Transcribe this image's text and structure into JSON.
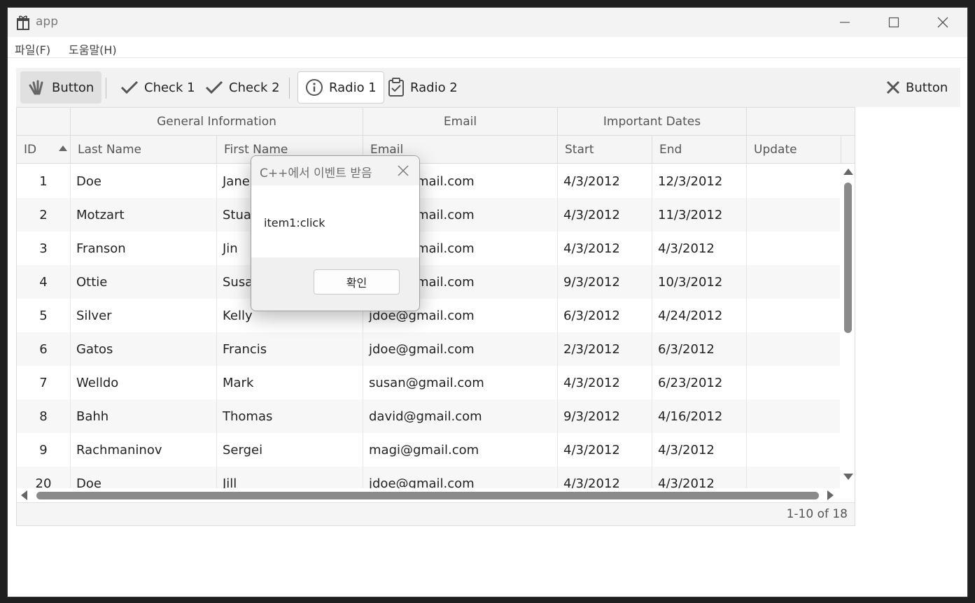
{
  "window": {
    "title": "app"
  },
  "menu": {
    "file": "파일(F)",
    "help": "도움말(H)"
  },
  "toolbar": {
    "button1": "Button",
    "check1": "Check 1",
    "check2": "Check 2",
    "radio1": "Radio 1",
    "radio2": "Radio 2",
    "button2": "Button"
  },
  "grid": {
    "groups": {
      "general": "General Information",
      "email": "Email",
      "dates": "Important Dates"
    },
    "columns": {
      "id": "ID",
      "last": "Last Name",
      "first": "First Name",
      "email": "Email",
      "start": "Start",
      "end": "End",
      "update": "Update"
    },
    "rows": [
      {
        "id": "1",
        "last": "Doe",
        "first": "Jane",
        "email": "jdoe@gmail.com",
        "start": "4/3/2012",
        "end": "12/3/2012",
        "update": ""
      },
      {
        "id": "2",
        "last": "Motzart",
        "first": "Stuart",
        "email": "jdoe@gmail.com",
        "start": "4/3/2012",
        "end": "11/3/2012",
        "update": ""
      },
      {
        "id": "3",
        "last": "Franson",
        "first": "Jin",
        "email": "jdoe@gmail.com",
        "start": "4/3/2012",
        "end": "4/3/2012",
        "update": ""
      },
      {
        "id": "4",
        "last": "Ottie",
        "first": "Susan",
        "email": "jdoe@gmail.com",
        "start": "9/3/2012",
        "end": "10/3/2012",
        "update": ""
      },
      {
        "id": "5",
        "last": "Silver",
        "first": "Kelly",
        "email": "jdoe@gmail.com",
        "start": "6/3/2012",
        "end": "4/24/2012",
        "update": ""
      },
      {
        "id": "6",
        "last": "Gatos",
        "first": "Francis",
        "email": "jdoe@gmail.com",
        "start": "2/3/2012",
        "end": "6/3/2012",
        "update": ""
      },
      {
        "id": "7",
        "last": "Welldo",
        "first": "Mark",
        "email": "susan@gmail.com",
        "start": "4/3/2012",
        "end": "6/23/2012",
        "update": ""
      },
      {
        "id": "8",
        "last": "Bahh",
        "first": "Thomas",
        "email": "david@gmail.com",
        "start": "9/3/2012",
        "end": "4/16/2012",
        "update": ""
      },
      {
        "id": "9",
        "last": "Rachmaninov",
        "first": "Sergei",
        "email": "magi@gmail.com",
        "start": "4/3/2012",
        "end": "4/3/2012",
        "update": ""
      },
      {
        "id": "20",
        "last": "Doe",
        "first": "Jill",
        "email": "jdoe@gmail.com",
        "start": "4/3/2012",
        "end": "4/3/2012",
        "update": ""
      }
    ],
    "pager": "1-10 of 18"
  },
  "dialog": {
    "title": "C++에서 이벤트 받음",
    "message": "item1:click",
    "ok": "확인"
  }
}
